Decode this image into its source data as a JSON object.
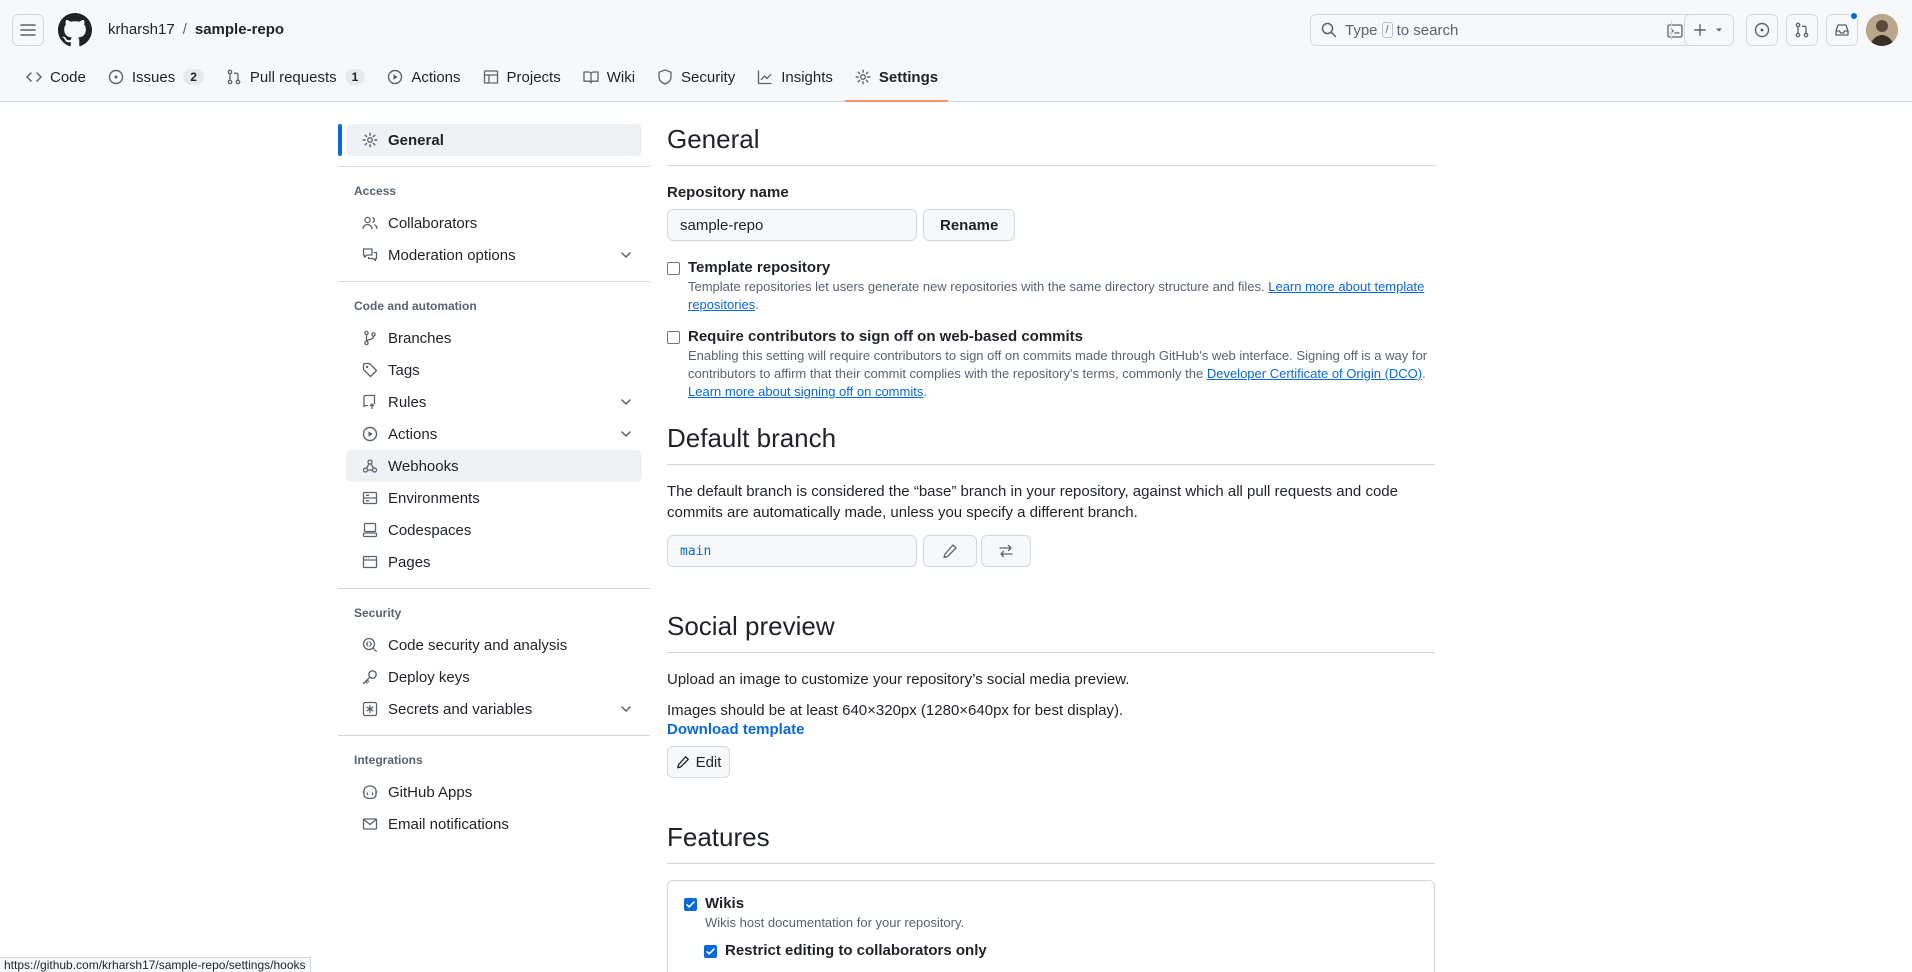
{
  "header": {
    "owner": "krharsh17",
    "separator": "/",
    "repo": "sample-repo",
    "search_prefix": "Type",
    "search_key": "/",
    "search_suffix": "to search"
  },
  "repo_nav": [
    {
      "label": "Code",
      "icon": "code-icon"
    },
    {
      "label": "Issues",
      "icon": "issue-icon",
      "count": "2"
    },
    {
      "label": "Pull requests",
      "icon": "pull-request-icon",
      "count": "1"
    },
    {
      "label": "Actions",
      "icon": "play-icon"
    },
    {
      "label": "Projects",
      "icon": "table-icon"
    },
    {
      "label": "Wiki",
      "icon": "book-icon"
    },
    {
      "label": "Security",
      "icon": "shield-icon"
    },
    {
      "label": "Insights",
      "icon": "graph-icon"
    },
    {
      "label": "Settings",
      "icon": "gear-icon",
      "active": true
    }
  ],
  "sidebar": {
    "general": "General",
    "access_heading": "Access",
    "access": [
      "Collaborators",
      "Moderation options"
    ],
    "code_heading": "Code and automation",
    "code": [
      "Branches",
      "Tags",
      "Rules",
      "Actions",
      "Webhooks",
      "Environments",
      "Codespaces",
      "Pages"
    ],
    "security_heading": "Security",
    "security": [
      "Code security and analysis",
      "Deploy keys",
      "Secrets and variables"
    ],
    "integrations_heading": "Integrations",
    "integrations": [
      "GitHub Apps",
      "Email notifications"
    ]
  },
  "general": {
    "title": "General",
    "repo_name_label": "Repository name",
    "repo_name_value": "sample-repo",
    "rename_button": "Rename",
    "template_title": "Template repository",
    "template_desc": "Template repositories let users generate new repositories with the same directory structure and files.",
    "template_link": "Learn more about template repositories",
    "signoff_title": "Require contributors to sign off on web-based commits",
    "signoff_desc": "Enabling this setting will require contributors to sign off on commits made through GitHub's web interface. Signing off is a way for contributors to affirm that their commit complies with the repository's terms, commonly the",
    "signoff_link": "Developer Certificate of Origin (DCO)",
    "signoff_learn": "Learn more about signing off on commits"
  },
  "default_branch": {
    "title": "Default branch",
    "desc": "The default branch is considered the “base” branch in your repository, against which all pull requests and code commits are automatically made, unless you specify a different branch.",
    "branch": "main"
  },
  "social_preview": {
    "title": "Social preview",
    "desc": "Upload an image to customize your repository’s social media preview.",
    "size_hint": "Images should be at least 640×320px (1280×640px for best display).",
    "download": "Download template",
    "edit_button": "Edit"
  },
  "features": {
    "title": "Features",
    "wikis_label": "Wikis",
    "wikis_desc": "Wikis host documentation for your repository.",
    "wikis_checked": true,
    "restrict_label": "Restrict editing to collaborators only"
  },
  "status_url": "https://github.com/krharsh17/sample-repo/settings/hooks",
  "colors": {
    "accent": "#0969da",
    "active_tab_underline": "#fd8c73"
  }
}
